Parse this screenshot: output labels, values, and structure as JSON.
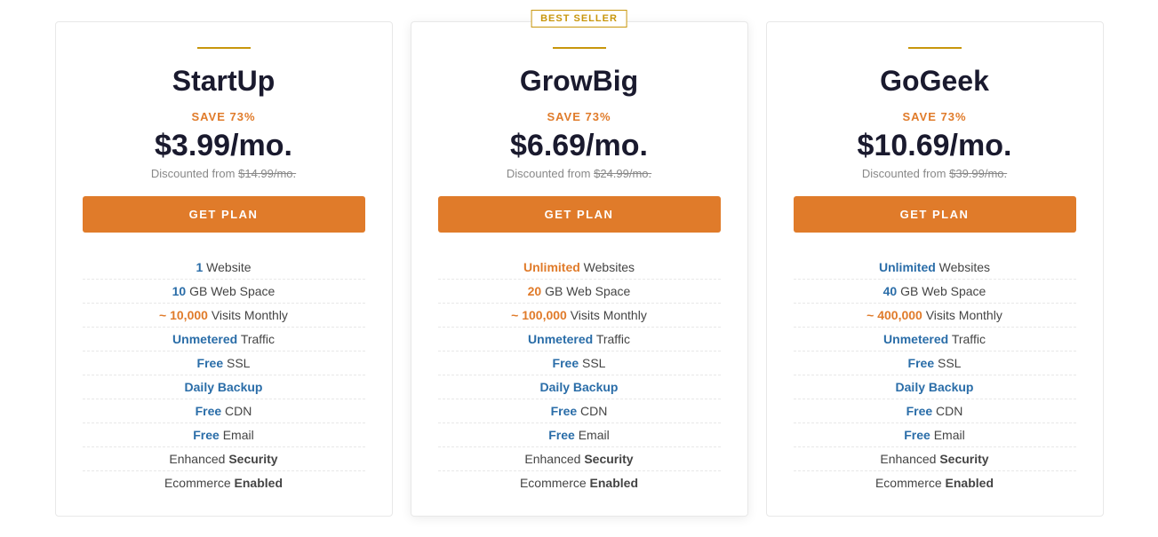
{
  "plans": [
    {
      "id": "startup",
      "name": "StartUp",
      "best_seller": false,
      "save_label": "SAVE 73%",
      "price": "$3.99/mo.",
      "discounted_from_label": "Discounted from",
      "original_price": "$14.99/mo.",
      "get_plan_label": "GET PLAN",
      "features": [
        {
          "bold": "1",
          "bold_color": "blue",
          "rest": " Website"
        },
        {
          "bold": "10",
          "bold_color": "blue",
          "rest": " GB Web Space"
        },
        {
          "bold": "~ 10,000",
          "bold_color": "orange",
          "rest": " Visits Monthly"
        },
        {
          "bold": "Unmetered",
          "bold_color": "blue",
          "rest": " Traffic"
        },
        {
          "bold": "Free",
          "bold_color": "blue",
          "rest": " SSL"
        },
        {
          "bold": "Daily Backup",
          "bold_color": "blue",
          "rest": ""
        },
        {
          "bold": "Free",
          "bold_color": "blue",
          "rest": " CDN"
        },
        {
          "bold": "Free",
          "bold_color": "blue",
          "rest": " Email"
        },
        {
          "bold": "Enhanced",
          "bold_color": "plain",
          "rest": " Security",
          "rest_bold": true
        },
        {
          "bold": "Ecommerce",
          "bold_color": "plain",
          "rest": " Enabled",
          "rest_bold": true
        }
      ]
    },
    {
      "id": "growbig",
      "name": "GrowBig",
      "best_seller": true,
      "best_seller_text": "BEST SELLER",
      "save_label": "SAVE 73%",
      "price": "$6.69/mo.",
      "discounted_from_label": "Discounted from",
      "original_price": "$24.99/mo.",
      "get_plan_label": "GET PLAN",
      "features": [
        {
          "bold": "Unlimited",
          "bold_color": "orange",
          "rest": " Websites"
        },
        {
          "bold": "20",
          "bold_color": "orange",
          "rest": " GB Web Space"
        },
        {
          "bold": "~ 100,000",
          "bold_color": "orange",
          "rest": " Visits Monthly"
        },
        {
          "bold": "Unmetered",
          "bold_color": "blue",
          "rest": " Traffic"
        },
        {
          "bold": "Free",
          "bold_color": "blue",
          "rest": " SSL"
        },
        {
          "bold": "Daily Backup",
          "bold_color": "blue",
          "rest": ""
        },
        {
          "bold": "Free",
          "bold_color": "blue",
          "rest": " CDN"
        },
        {
          "bold": "Free",
          "bold_color": "blue",
          "rest": " Email"
        },
        {
          "bold": "Enhanced",
          "bold_color": "plain",
          "rest": " Security",
          "rest_bold": true
        },
        {
          "bold": "Ecommerce",
          "bold_color": "plain",
          "rest": " Enabled",
          "rest_bold": true
        }
      ]
    },
    {
      "id": "gogeek",
      "name": "GoGeek",
      "best_seller": false,
      "save_label": "SAVE 73%",
      "price": "$10.69/mo.",
      "discounted_from_label": "Discounted from",
      "original_price": "$39.99/mo.",
      "get_plan_label": "GET PLAN",
      "features": [
        {
          "bold": "Unlimited",
          "bold_color": "blue",
          "rest": " Websites"
        },
        {
          "bold": "40",
          "bold_color": "blue",
          "rest": " GB Web Space"
        },
        {
          "bold": "~ 400,000",
          "bold_color": "orange",
          "rest": " Visits Monthly"
        },
        {
          "bold": "Unmetered",
          "bold_color": "blue",
          "rest": " Traffic"
        },
        {
          "bold": "Free",
          "bold_color": "blue",
          "rest": " SSL"
        },
        {
          "bold": "Daily Backup",
          "bold_color": "blue",
          "rest": ""
        },
        {
          "bold": "Free",
          "bold_color": "blue",
          "rest": " CDN"
        },
        {
          "bold": "Free",
          "bold_color": "blue",
          "rest": " Email"
        },
        {
          "bold": "Enhanced",
          "bold_color": "plain",
          "rest": " Security",
          "rest_bold": true
        },
        {
          "bold": "Ecommerce",
          "bold_color": "plain",
          "rest": " Enabled",
          "rest_bold": true
        }
      ]
    }
  ]
}
